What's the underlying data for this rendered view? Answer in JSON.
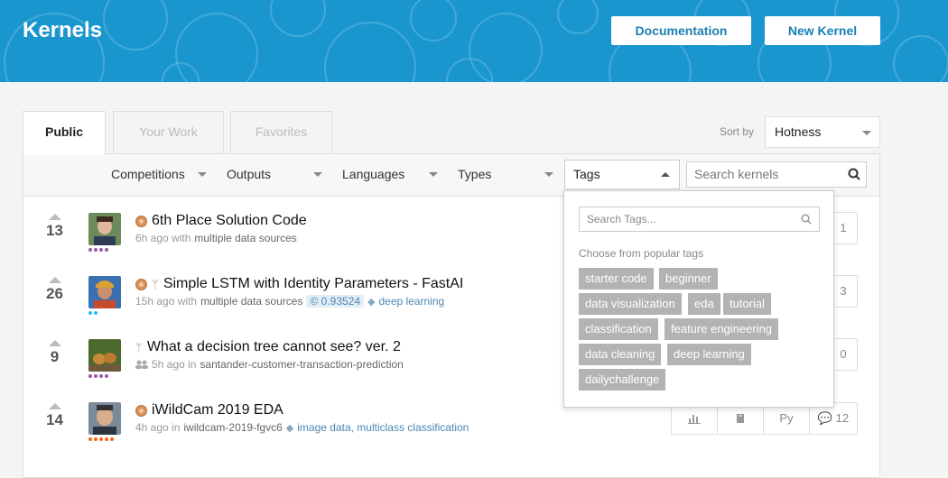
{
  "header": {
    "title": "Kernels",
    "documentation_label": "Documentation",
    "new_kernel_label": "New Kernel",
    "bg_color": "#1a96cf"
  },
  "tabs": [
    {
      "label": "Public",
      "active": true
    },
    {
      "label": "Your Work",
      "active": false
    },
    {
      "label": "Favorites",
      "active": false
    }
  ],
  "sort": {
    "label": "Sort by",
    "value": "Hotness"
  },
  "filters": {
    "competitions": "Competitions",
    "outputs": "Outputs",
    "languages": "Languages",
    "types": "Types",
    "tags": "Tags",
    "search_placeholder": "Search kernels"
  },
  "kernels": [
    {
      "votes": "13",
      "title": "6th Place Solution Code",
      "meta_time": "6h ago with",
      "meta_source": "multiple data sources",
      "stat": "1"
    },
    {
      "votes": "26",
      "title": "Simple LSTM with Identity Parameters - FastAI",
      "meta_time": "15h ago with",
      "meta_source": "multiple data sources",
      "score": "0.93524",
      "tags": "deep learning",
      "stat": "3"
    },
    {
      "votes": "9",
      "title": "What a decision tree cannot see? ver. 2",
      "meta_time": "5h ago in",
      "meta_source": "santander-customer-transaction-prediction",
      "stat": "0"
    },
    {
      "votes": "14",
      "title": "iWildCam 2019 EDA",
      "meta_time": "4h ago in",
      "meta_source": "iwildcam-2019-fgvc6",
      "tags": "image data, multiclass classification",
      "lang": "Py",
      "comments": "12"
    }
  ],
  "tags_dropdown": {
    "search_placeholder": "Search Tags...",
    "popular_label": "Choose from popular tags",
    "chips": [
      "starter code",
      "beginner",
      "data visualization",
      "eda",
      "tutorial",
      "classification",
      "feature engineering",
      "data cleaning",
      "deep learning",
      "dailychallenge"
    ]
  }
}
